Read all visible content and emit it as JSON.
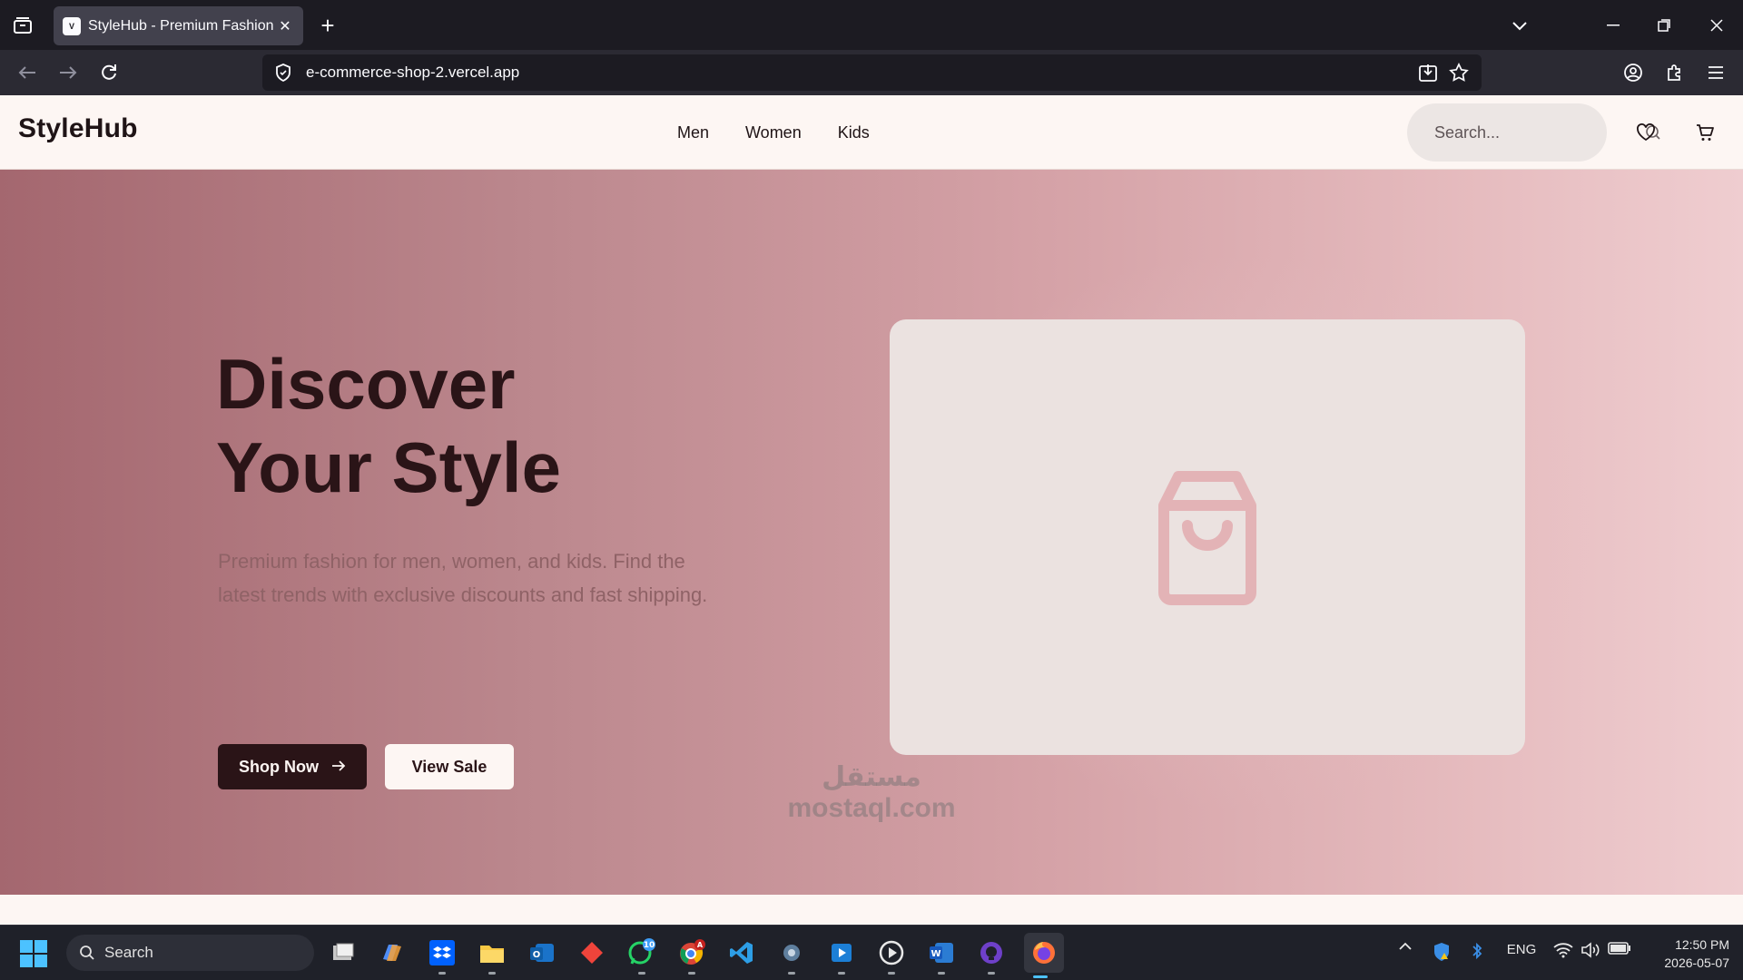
{
  "browser": {
    "tab_title": "StyleHub - Premium Fashion E-c",
    "favicon_text": "V",
    "url": "e-commerce-shop-2.vercel.app"
  },
  "site": {
    "logo": "StyleHub",
    "nav": [
      "Men",
      "Women",
      "Kids"
    ],
    "search_placeholder": "Search..."
  },
  "hero": {
    "title_line1": "Discover",
    "title_line2": "Your Style",
    "subtitle": "Premium fashion for men, women, and kids. Find the latest trends with exclusive discounts and fast shipping.",
    "primary_button": "Shop Now",
    "secondary_button": "View Sale"
  },
  "watermark": {
    "line1": "مستقل",
    "line2": "mostaql.com"
  },
  "taskbar": {
    "search_label": "Search",
    "whatsapp_badge": "10",
    "chrome_badge": "A",
    "language": "ENG",
    "time": "12:50 PM",
    "date": "2026-05-07"
  },
  "colors": {
    "hero_start": "#a4676f",
    "hero_end": "#efcdd0",
    "primary_dark": "#2a1417",
    "card_bg": "#ebe2e0",
    "bag_icon": "#e3b3b6"
  }
}
